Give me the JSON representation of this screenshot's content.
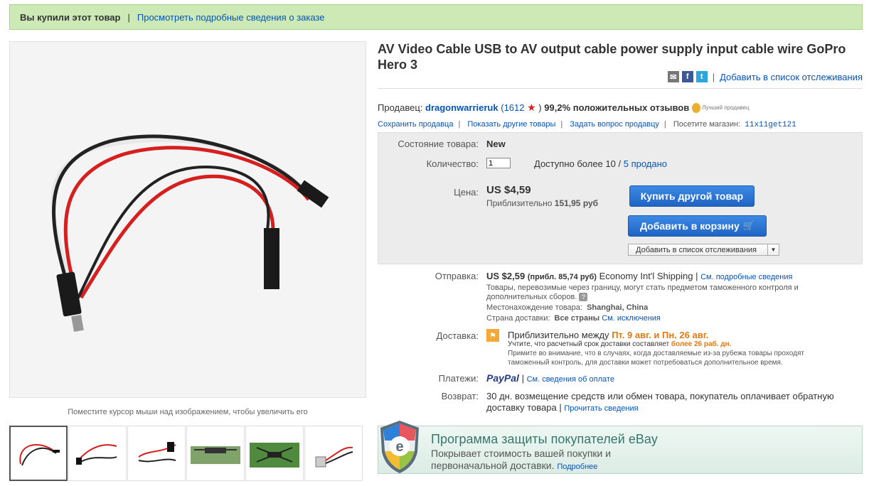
{
  "banner": {
    "bought": "Вы купили этот товар",
    "separator": "|",
    "details_link": "Просмотреть подробные сведения о заказе"
  },
  "gallery": {
    "hint": "Поместите курсор мыши над изображением, чтобы увеличить его",
    "thumbnails": [
      "cable-1",
      "cable-2",
      "cable-3",
      "drone-1",
      "drone-2",
      "camera-cable"
    ]
  },
  "item": {
    "title": "AV Video Cable USB to AV output cable power supply input cable wire GoPro Hero 3",
    "watch_link": "Добавить в список отслеживания"
  },
  "seller": {
    "label": "Продавец:",
    "name": "dragonwarrieruk",
    "score_open": "(1612",
    "score_close": ")",
    "feedback": "99,2% положительных отзывов",
    "top_badge": "Лучший продавец",
    "links": [
      "Сохранить продавца",
      "Показать другие товары",
      "Задать вопрос продавцу"
    ],
    "store_label": "Посетите магазин:",
    "store_name": "11x11get121"
  },
  "purchase": {
    "condition_label": "Состояние товара:",
    "condition_value": "New",
    "quantity_label": "Количество:",
    "quantity_value": "1",
    "available": "Доступно более 10",
    "sold_sep": "/",
    "sold": "5 продано",
    "price_label": "Цена:",
    "price": "US $4,59",
    "approx_label": "Приблизительно",
    "approx_value": "151,95 руб",
    "buy_button": "Купить другой товар",
    "cart_button": "Добавить в корзину",
    "watch_select": "Добавить в список отслеживания"
  },
  "shipping": {
    "label": "Отправка:",
    "price": "US $2,59",
    "approx": "(прибл. 85,74 руб)",
    "method": "Economy Int'l Shipping",
    "details_link": "См. подробные сведения",
    "customs_note": "Товары, перевозимые через границу, могут стать предметом таможенного контроля и дополнительных сборов.",
    "location_label": "Местонахождение товара:",
    "location": "Shanghai, China",
    "countries_label": "Страна доставки:",
    "countries": "Все страны",
    "exceptions_link": "См. исключения"
  },
  "delivery": {
    "label": "Доставка:",
    "estimate_prefix": "Приблизительно между",
    "estimate_dates": "Пт. 9 авг. и Пн. 26 авг.",
    "note_prefix": "Учтите, что расчетный срок доставки составляет",
    "note_days": "более 26 раб. дн.",
    "note_customs": "Примите во внимание, что в случаях, когда доставляемые из-за рубежа товары проходят таможенный контроль, для доставки может потребоваться дополнительное время."
  },
  "payment": {
    "label": "Платежи:",
    "paypal": "PayPal",
    "details_link": "См. сведения об оплате"
  },
  "returns": {
    "label": "Возврат:",
    "text": "30 дн. возмещение средств или обмен товара, покупатель оплачивает обратную доставку товара",
    "link": "Прочитать сведения"
  },
  "protection": {
    "title": "Программа защиты покупателей eBay",
    "text": "Покрывает стоимость вашей покупки и первоначальной доставки.",
    "link": "Подробнее"
  },
  "colors": {
    "link": "#0654ba",
    "banner_bg": "#cde9b5",
    "button_blue": "#1f64c4",
    "orange": "#e47911"
  }
}
